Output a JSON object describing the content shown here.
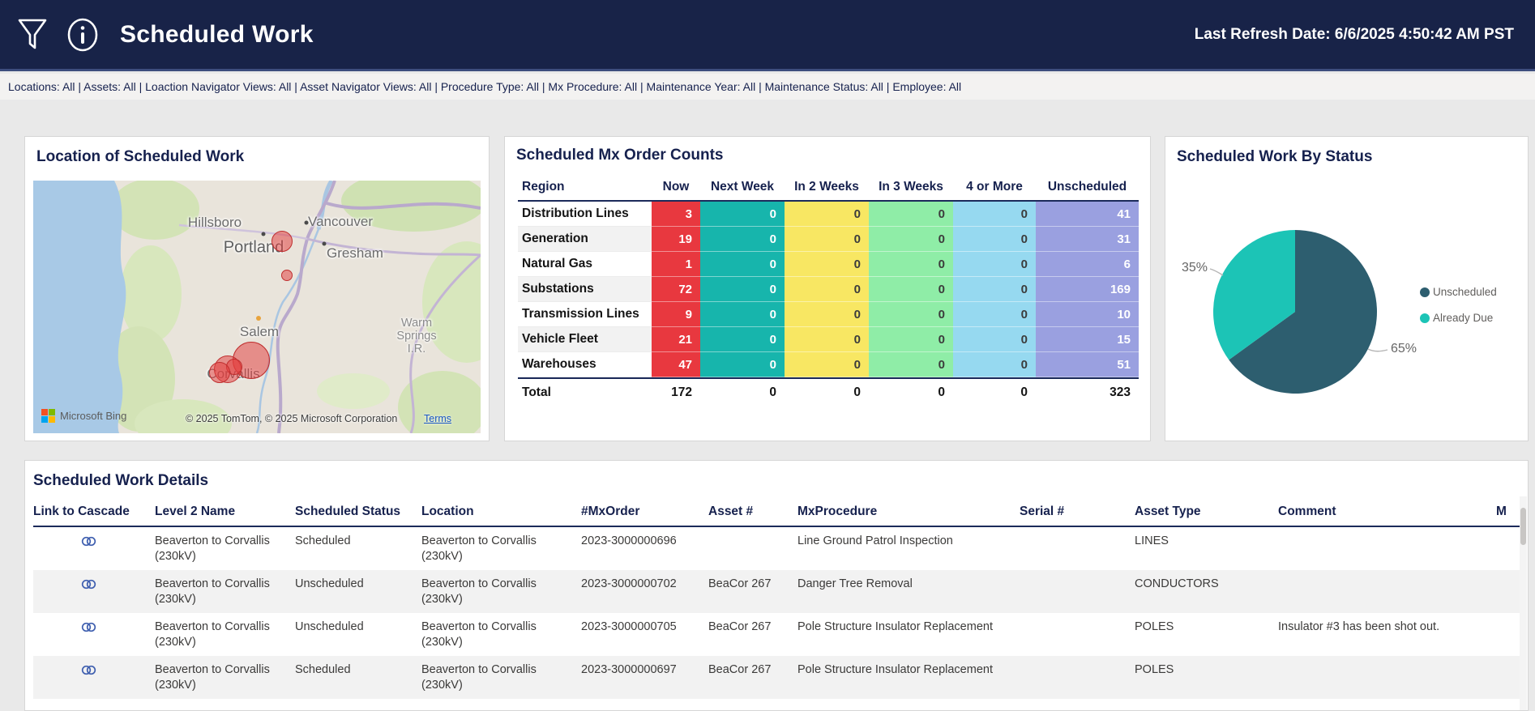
{
  "theme": {
    "header_bg": "#182348",
    "title_navy": "#16214e",
    "status_red": "#e8383f",
    "status_teal": "#17b5ac",
    "status_yellow": "#f8e763",
    "status_green": "#8feda7",
    "status_blue": "#96d9f0",
    "status_periwinkle": "#9aa0e0"
  },
  "header": {
    "title": "Scheduled Work",
    "last_refresh": "Last Refresh Date: 6/6/2025 4:50:42 AM PST",
    "filter_icon": "funnel-icon",
    "info_icon": "info-icon",
    "info_glyph": "i"
  },
  "filter_bar": {
    "text": "Locations: All | Assets: All | Loaction Navigator Views: All | Asset Navigator Views: All | Procedure Type: All | Mx Procedure: All | Maintenance Year: All | Maintenance Status: All | Employee: All"
  },
  "map_panel": {
    "title": "Location of Scheduled Work",
    "cities": {
      "hillsboro": "Hillsboro",
      "vancouver": "Vancouver",
      "portland": "Portland",
      "gresham": "Gresham",
      "salem": "Salem",
      "corvallis": "Corvallis",
      "warm_springs_line1": "Warm",
      "warm_springs_line2": "Springs",
      "warm_springs_line3": "I.R."
    },
    "logo_text": "Microsoft Bing",
    "attribution": "© 2025 TomTom, © 2025 Microsoft Corporation",
    "terms_link": "Terms"
  },
  "counts_panel": {
    "title": "Scheduled Mx Order Counts",
    "columns": [
      "Region",
      "Now",
      "Next Week",
      "In 2 Weeks",
      "In 3 Weeks",
      "4 or More",
      "Unscheduled"
    ],
    "colors": {
      "now": {
        "bg": "#e8383f",
        "fg": "#ffffff"
      },
      "next_week": {
        "bg": "#17b5ac",
        "fg": "#ffffff"
      },
      "in_2_weeks": {
        "bg": "#f8e763",
        "fg": "#3c3c3c"
      },
      "in_3_weeks": {
        "bg": "#8feda7",
        "fg": "#3c3c3c"
      },
      "four_or_more": {
        "bg": "#96d9f0",
        "fg": "#3c3c3c"
      },
      "unscheduled": {
        "bg": "#9aa0e0",
        "fg": "#ffffff"
      }
    },
    "rows": [
      {
        "region": "Distribution Lines",
        "values": [
          3,
          0,
          0,
          0,
          0,
          41
        ]
      },
      {
        "region": "Generation",
        "values": [
          19,
          0,
          0,
          0,
          0,
          31
        ]
      },
      {
        "region": "Natural Gas",
        "values": [
          1,
          0,
          0,
          0,
          0,
          6
        ]
      },
      {
        "region": "Substations",
        "values": [
          72,
          0,
          0,
          0,
          0,
          169
        ]
      },
      {
        "region": "Transmission Lines",
        "values": [
          9,
          0,
          0,
          0,
          0,
          10
        ]
      },
      {
        "region": "Vehicle Fleet",
        "values": [
          21,
          0,
          0,
          0,
          0,
          15
        ]
      },
      {
        "region": "Warehouses",
        "values": [
          47,
          0,
          0,
          0,
          0,
          51
        ]
      }
    ],
    "total_row": {
      "label": "Total",
      "values": [
        172,
        0,
        0,
        0,
        0,
        323
      ]
    }
  },
  "status_panel": {
    "title": "Scheduled Work By Status"
  },
  "chart_data": {
    "type": "pie",
    "title": "Scheduled Work By Status",
    "legend_position": "right",
    "slices": [
      {
        "label": "Unscheduled",
        "percent": 65,
        "percent_label": "65%",
        "color": "#2d5e6f"
      },
      {
        "label": "Already Due",
        "percent": 35,
        "percent_label": "35%",
        "color": "#1cc4b6"
      }
    ]
  },
  "details_panel": {
    "title": "Scheduled Work Details",
    "columns": [
      "Link to Cascade",
      "Level 2 Name",
      "Scheduled Status",
      "Location",
      "#MxOrder",
      "Asset #",
      "MxProcedure",
      "Serial #",
      "Asset Type",
      "Comment",
      "M"
    ],
    "rows": [
      {
        "level2": "Beaverton to Corvallis (230kV)",
        "status": "Scheduled",
        "location": "Beaverton to Corvallis (230kV)",
        "mx_order": "2023-3000000696",
        "asset": "",
        "procedure": "Line Ground Patrol Inspection",
        "serial": "",
        "asset_type": "LINES",
        "comment": ""
      },
      {
        "level2": "Beaverton to Corvallis (230kV)",
        "status": "Unscheduled",
        "location": "Beaverton to Corvallis (230kV)",
        "mx_order": "2023-3000000702",
        "asset": "BeaCor 267",
        "procedure": "Danger Tree Removal",
        "serial": "",
        "asset_type": "CONDUCTORS",
        "comment": ""
      },
      {
        "level2": "Beaverton to Corvallis (230kV)",
        "status": "Unscheduled",
        "location": "Beaverton to Corvallis (230kV)",
        "mx_order": "2023-3000000705",
        "asset": "BeaCor 267",
        "procedure": "Pole Structure Insulator Replacement",
        "serial": "",
        "asset_type": "POLES",
        "comment": "Insulator #3 has been shot out."
      },
      {
        "level2": "Beaverton to Corvallis (230kV)",
        "status": "Scheduled",
        "location": "Beaverton to Corvallis (230kV)",
        "mx_order": "2023-3000000697",
        "asset": "BeaCor 267",
        "procedure": "Pole Structure Insulator Replacement",
        "serial": "",
        "asset_type": "POLES",
        "comment": ""
      }
    ]
  }
}
